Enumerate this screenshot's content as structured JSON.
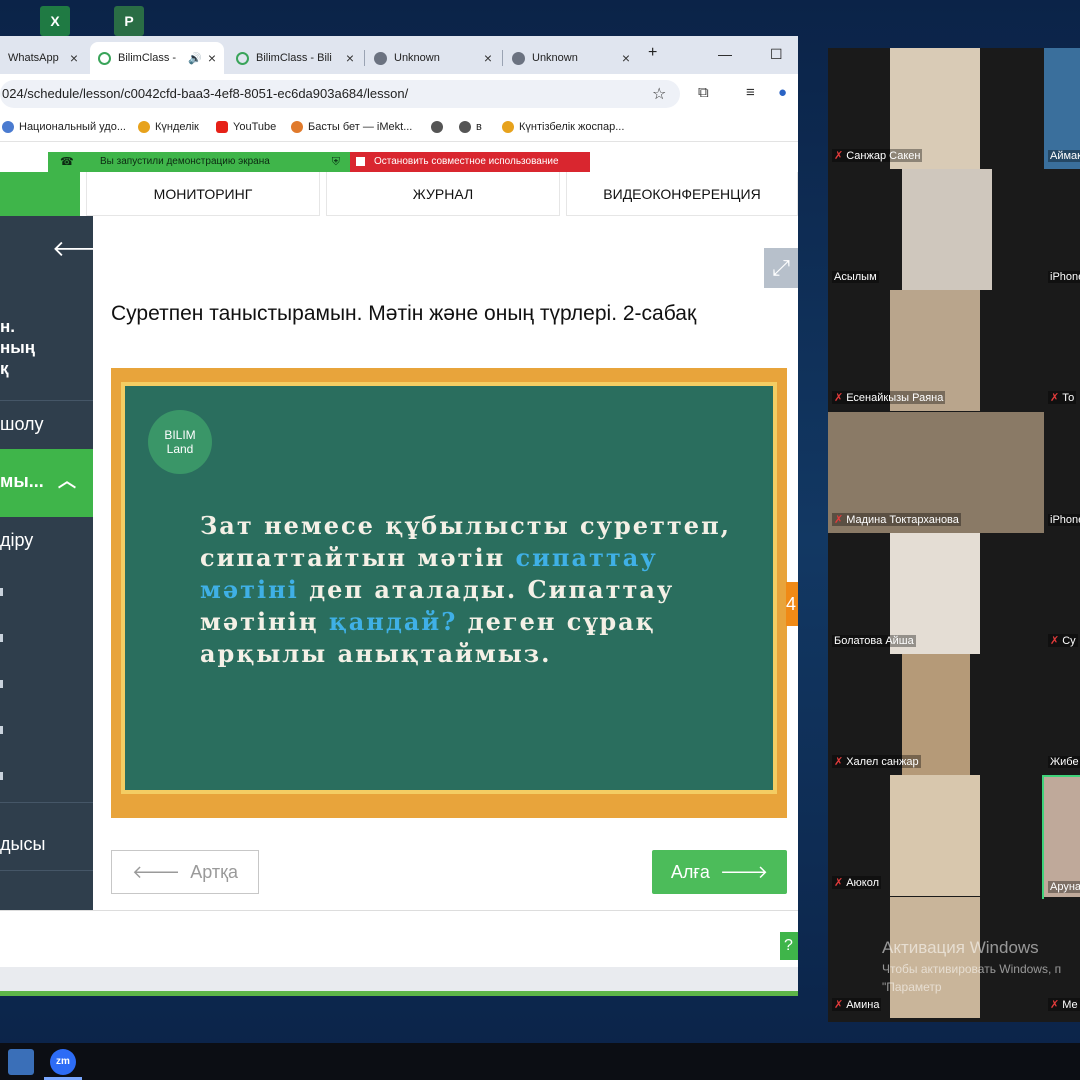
{
  "browser": {
    "tabs": [
      {
        "title": "WhatsApp",
        "icon": "whatsapp-icon"
      },
      {
        "title": "BilimClass -",
        "icon": "bilimclass-icon",
        "audio": true
      },
      {
        "title": "BilimClass - Bili",
        "icon": "bilimclass-icon"
      },
      {
        "title": "Unknown",
        "icon": "globe-icon"
      },
      {
        "title": "Unknown",
        "icon": "globe-icon"
      }
    ],
    "new_tab": "+",
    "url": "024/schedule/lesson/c0042cfd-baa3-4ef8-8051-ec6da903a684/lesson/",
    "bookmarks": [
      {
        "label": "Национальный удо...",
        "color": "#4a7bd0"
      },
      {
        "label": "Күнделік",
        "color": "#e7a21c"
      },
      {
        "label": "YouTube",
        "color": "#e62117"
      },
      {
        "label": "Басты бет — iMekt...",
        "color": "#e07a2c"
      },
      {
        "label": "",
        "color": "#555555"
      },
      {
        "label": "в",
        "color": "#555555"
      },
      {
        "label": "Күнтізбелік жоспар...",
        "color": "#e7a21c"
      }
    ]
  },
  "share": {
    "started": "Вы запустили демонстрацию экрана",
    "stop": "Остановить совместное использование"
  },
  "nav": {
    "tabs": [
      "МОНИТОРИНГ",
      "ЖУРНАЛ",
      "ВИДЕОКОНФЕРЕНЦИЯ"
    ]
  },
  "sidebar": {
    "title": "н.\nның\nқ",
    "items": [
      "шолу",
      "ды",
      "ыцы"
    ],
    "active": "мы...",
    "sub_item": "діру",
    "bottom": "дысы"
  },
  "lesson": {
    "title": "Суретпен таныстырамын. Мәтін және оның түрлері. 2-сабақ",
    "logo_line1": "BILIM",
    "logo_line2": "Land",
    "text_part1": "Зат немесе құбылысты суреттеп, сипаттайтын мәтін ",
    "text_hl1": "сипаттау мәтіні",
    "text_part2": " деп аталады. Сипаттау мәтінің ",
    "text_hl2": "қандай?",
    "text_part3": " деген сұрақ арқылы анықтаймыз.",
    "orange_tab": "4",
    "back_label": "Артқа",
    "next_label": "Алға",
    "help": "?"
  },
  "zoom": {
    "participants": [
      {
        "name": "Санжар Сакен"
      },
      {
        "name": "Аймак"
      },
      {
        "name": "Асылым"
      },
      {
        "name": "iPhone"
      },
      {
        "name": "Есенайкызы Раяна"
      },
      {
        "name": "То"
      },
      {
        "name": "Мадина Токтарханова"
      },
      {
        "name": "iPhone"
      },
      {
        "name": "Болатова Айша"
      },
      {
        "name": "Су"
      },
      {
        "name": "Халел санжар"
      },
      {
        "name": "Жибе"
      },
      {
        "name": "Аюкол"
      },
      {
        "name": "Аруна"
      },
      {
        "name": "Амина"
      },
      {
        "name": "Ме"
      }
    ]
  },
  "windows": {
    "activate_title": "Активация Windows",
    "activate_line1": "Чтобы активировать Windows, п",
    "activate_line2": "\"Параметр"
  },
  "taskbar": {
    "zoom_label": "zm"
  }
}
